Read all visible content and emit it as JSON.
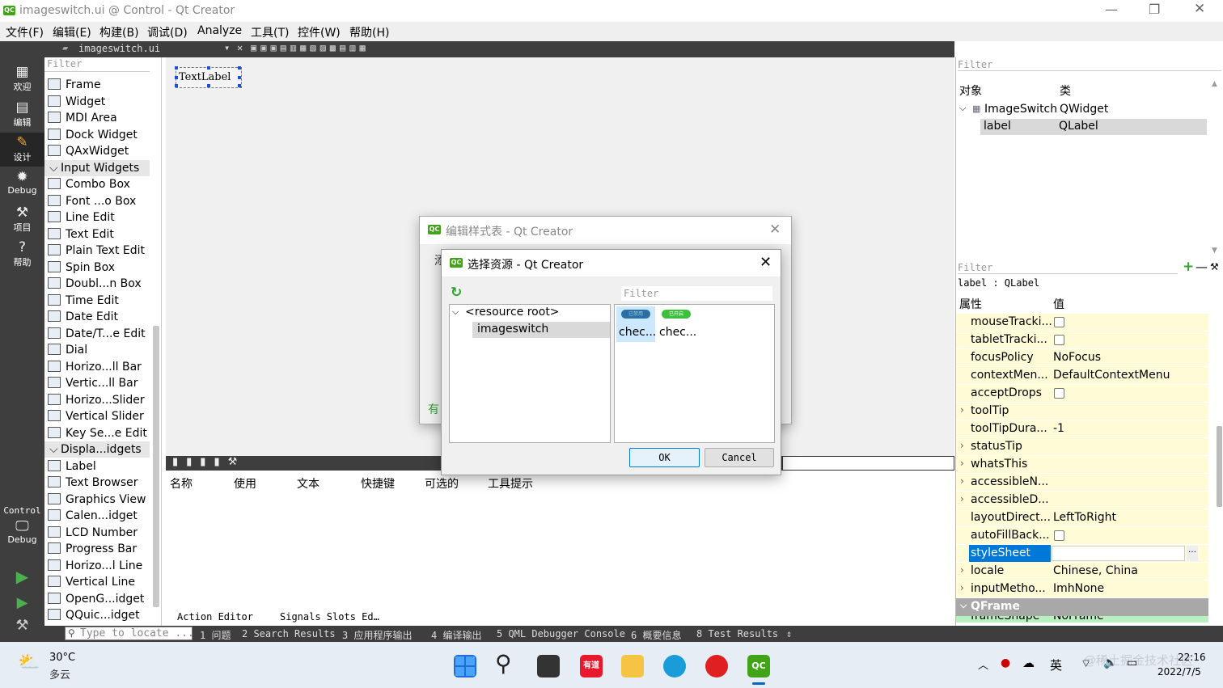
{
  "window": {
    "title": "imageswitch.ui @ Control - Qt Creator",
    "app_icon": "QC"
  },
  "menu": [
    "文件(F)",
    "编辑(E)",
    "构建(B)",
    "调试(D)",
    "Analyze",
    "工具(T)",
    "控件(W)",
    "帮助(H)"
  ],
  "modes": [
    {
      "icon": "grid-icon",
      "label": "欢迎"
    },
    {
      "icon": "edit-icon",
      "label": "编辑"
    },
    {
      "icon": "design-icon",
      "label": "设计"
    },
    {
      "icon": "debug-icon",
      "label": "Debug"
    },
    {
      "icon": "wrench-icon",
      "label": "项目"
    },
    {
      "icon": "help-icon",
      "label": "帮助"
    }
  ],
  "kit": {
    "project": "Control",
    "mode": "Debug"
  },
  "editor_tab": "imageswitch.ui",
  "widgetbox": {
    "filter_placeholder": "Filter",
    "items": [
      {
        "t": "Frame"
      },
      {
        "t": "Widget"
      },
      {
        "t": "MDI Area"
      },
      {
        "t": "Dock Widget"
      },
      {
        "t": "QAxWidget"
      },
      {
        "t": "Input Widgets",
        "cat": true
      },
      {
        "t": "Combo Box"
      },
      {
        "t": "Font ...o Box"
      },
      {
        "t": "Line Edit"
      },
      {
        "t": "Text Edit"
      },
      {
        "t": "Plain Text Edit"
      },
      {
        "t": "Spin Box"
      },
      {
        "t": "Doubl...n Box"
      },
      {
        "t": "Time Edit"
      },
      {
        "t": "Date Edit"
      },
      {
        "t": "Date/T...e Edit"
      },
      {
        "t": "Dial"
      },
      {
        "t": "Horizo...ll Bar"
      },
      {
        "t": "Vertic...ll Bar"
      },
      {
        "t": "Horizo...Slider"
      },
      {
        "t": "Vertical Slider"
      },
      {
        "t": "Key Se...e Edit"
      },
      {
        "t": "Displa...idgets",
        "cat": true
      },
      {
        "t": "Label"
      },
      {
        "t": "Text Browser"
      },
      {
        "t": "Graphics View"
      },
      {
        "t": "Calen...idget"
      },
      {
        "t": "LCD Number"
      },
      {
        "t": "Progress Bar"
      },
      {
        "t": "Horizo...l Line"
      },
      {
        "t": "Vertical Line"
      },
      {
        "t": "OpenG...idget"
      },
      {
        "t": "QQuic...idget"
      }
    ]
  },
  "form": {
    "text_label": "TextLabel"
  },
  "action_editor": {
    "columns": [
      "名称",
      "使用",
      "文本",
      "快捷键",
      "可选的",
      "工具提示"
    ],
    "tabs": [
      "Action Editor",
      "Signals Slots Ed…"
    ]
  },
  "object_inspector": {
    "filter_placeholder": "Filter",
    "col_object": "对象",
    "col_class": "类",
    "rows": [
      {
        "obj": "ImageSwitch",
        "cls": "QWidget"
      },
      {
        "obj": "label",
        "cls": "QLabel"
      }
    ]
  },
  "property_editor": {
    "filter_placeholder": "Filter",
    "context": "label : QLabel",
    "col_prop": "属性",
    "col_val": "值",
    "rows": [
      {
        "k": "mouseTracki...",
        "cb": true
      },
      {
        "k": "tabletTracki...",
        "cb": true
      },
      {
        "k": "focusPolicy",
        "v": "NoFocus"
      },
      {
        "k": "contextMen...",
        "v": "DefaultContextMenu"
      },
      {
        "k": "acceptDrops",
        "cb": true
      },
      {
        "k": "toolTip",
        "ex": true
      },
      {
        "k": "toolTipDura...",
        "v": "-1"
      },
      {
        "k": "statusTip",
        "ex": true
      },
      {
        "k": "whatsThis",
        "ex": true
      },
      {
        "k": "accessibleN...",
        "ex": true
      },
      {
        "k": "accessibleD...",
        "ex": true
      },
      {
        "k": "layoutDirect...",
        "v": "LeftToRight"
      },
      {
        "k": "autoFillBack...",
        "cb": true
      },
      {
        "k": "styleSheet",
        "sel": true
      },
      {
        "k": "locale",
        "v": "Chinese, China",
        "ex": true
      },
      {
        "k": "inputMetho...",
        "v": "ImhNone",
        "ex": true
      }
    ],
    "group": "QFrame",
    "partial": "frameShape",
    "partial_val": "NoFrame"
  },
  "status": {
    "locate_placeholder": "Type to locate ...",
    "panes": [
      "1 问题",
      "2 Search Results",
      "3 应用程序输出",
      "4 编译输出",
      "5 QML Debugger Console",
      "6 概要信息",
      "8 Test Results"
    ]
  },
  "dialog_stylesheet": {
    "title": "编辑样式表 - Qt Creator",
    "partial_left": "添",
    "partial_bottom": "有"
  },
  "dialog_resource": {
    "title": "选择资源 - Qt Creator",
    "filter_placeholder": "Filter",
    "tree_root": "<resource root>",
    "tree_child": "imageswitch",
    "images": [
      {
        "label": "chec...",
        "badge": "已禁用"
      },
      {
        "label": "chec...",
        "badge": "已开启"
      }
    ],
    "ok": "OK",
    "cancel": "Cancel"
  },
  "taskbar": {
    "weather_temp": "30°C",
    "weather_desc": "多云",
    "ime": "英",
    "time": "22:16",
    "date": "2022/7/5",
    "watermark": "@稀土掘金技术社区",
    "youdao": "有道",
    "qc": "QC"
  }
}
